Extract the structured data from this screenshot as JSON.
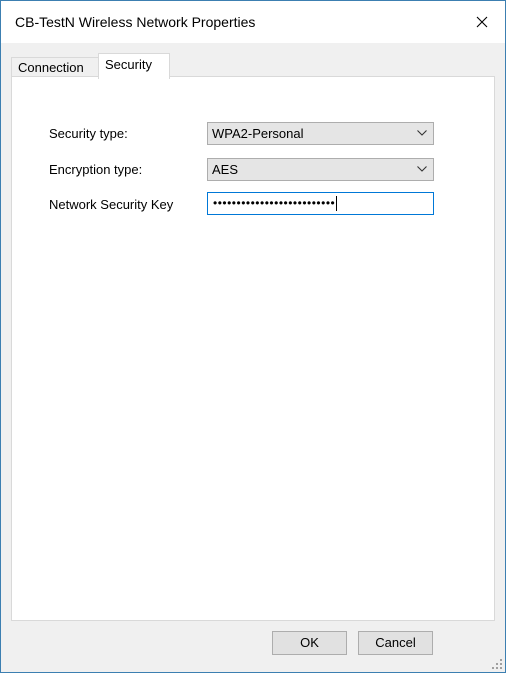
{
  "window": {
    "title": "CB-TestN Wireless Network Properties"
  },
  "tabs": [
    {
      "label": "Connection",
      "selected": false
    },
    {
      "label": "Security",
      "selected": true
    }
  ],
  "security": {
    "security_type_label": "Security type:",
    "security_type_value": "WPA2-Personal",
    "encryption_type_label": "Encryption type:",
    "encryption_type_value": "AES",
    "network_key_label": "Network Security Key",
    "network_key_masked": "••••••••••••••••••••••••••"
  },
  "buttons": {
    "ok": "OK",
    "cancel": "Cancel"
  },
  "colors": {
    "window_border": "#3c7fb1",
    "focus_border": "#0078d7"
  },
  "icons": {
    "close": "close-icon",
    "dropdown": "chevron-down-icon",
    "resize": "resize-grip-icon"
  }
}
